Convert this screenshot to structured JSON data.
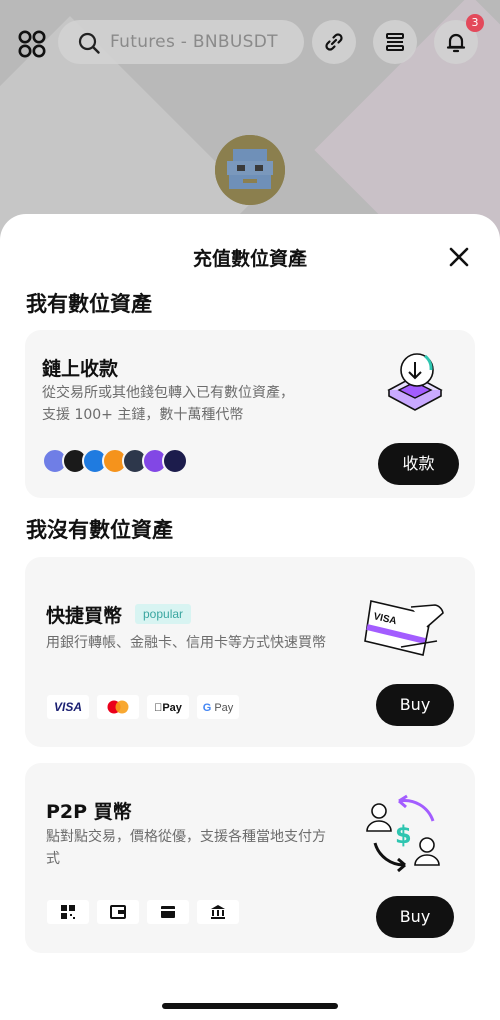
{
  "header": {
    "search_placeholder": "Futures - BNBUSDT",
    "notification_count": "3"
  },
  "sheet": {
    "title": "充值數位資產",
    "section_have": "我有數位資產",
    "section_not_have": "我沒有數位資產"
  },
  "onchain_card": {
    "title": "鏈上收款",
    "desc_line1": "從交易所或其他錢包轉入已有數位資產，",
    "desc_line2": "支援 100+ 主鏈，數十萬種代幣",
    "button": "收款",
    "coins": [
      {
        "icon": "ethereum-icon",
        "color": "#6f7ee6"
      },
      {
        "icon": "solana-icon",
        "color": "#1a1a1a"
      },
      {
        "icon": "dash-icon",
        "color": "#1f7be0"
      },
      {
        "icon": "bitcoin-icon",
        "color": "#f5931c"
      },
      {
        "icon": "arbitrum-icon",
        "color": "#2d374b"
      },
      {
        "icon": "polygon-icon",
        "color": "#8247e5"
      },
      {
        "icon": "starknet-icon",
        "color": "#1c1c4c"
      }
    ]
  },
  "quick_buy_card": {
    "title": "快捷買幣",
    "tag": "popular",
    "desc": "用銀行轉帳、金融卡、信用卡等方式快速買幣",
    "button": "Buy",
    "payments": [
      "VISA",
      "Mastercard",
      "Apple Pay",
      "G Pay"
    ],
    "illustration_text": "VISA"
  },
  "p2p_card": {
    "title": "P2P 買幣",
    "desc_line1": "點對點交易，價格從優，支援各種當地支付方",
    "desc_line2": "式",
    "button": "Buy",
    "payments": [
      "qr-code-icon",
      "wallet-icon",
      "card-icon",
      "bank-icon"
    ]
  },
  "colors": {
    "accent_purple": "#a35dff",
    "accent_teal": "#2ec5b0",
    "button_dark": "#111111",
    "card_bg": "#f6f6f6"
  }
}
